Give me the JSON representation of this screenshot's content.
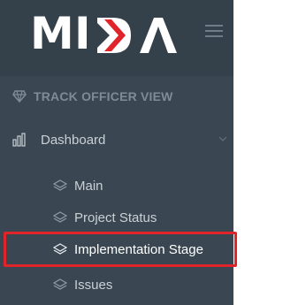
{
  "brand": {
    "logo_text": "MIDA",
    "accent_color": "#e0252a",
    "sidebar_color": "#3a4651"
  },
  "header": {
    "menu_toggle_icon": "hamburger-icon"
  },
  "sidebar": {
    "section_title": "TRACK OFFICER VIEW",
    "section_icon": "diamond-icon",
    "dashboard": {
      "label": "Dashboard",
      "icon": "bar-chart-icon",
      "expand_icon": "chevron-down-icon",
      "children": [
        {
          "label": "Main",
          "icon": "layers-icon"
        },
        {
          "label": "Project Status",
          "icon": "layers-icon"
        },
        {
          "label": "Implementation Stage",
          "icon": "layers-icon",
          "active": true
        },
        {
          "label": "Issues",
          "icon": "layers-icon"
        }
      ]
    }
  }
}
